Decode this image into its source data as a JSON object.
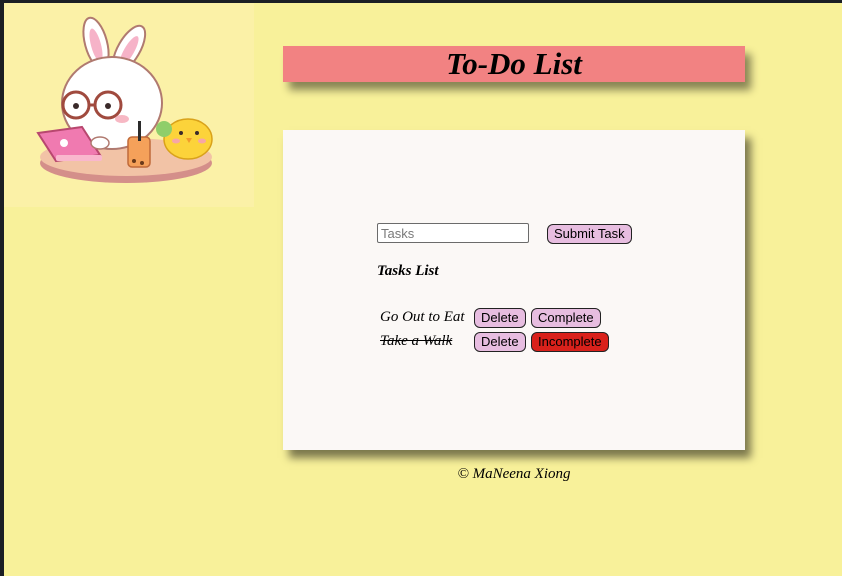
{
  "header": {
    "title": "To-Do List"
  },
  "form": {
    "placeholder": "Tasks",
    "value": "",
    "submit_label": "Submit Task"
  },
  "list": {
    "heading": "Tasks List",
    "tasks": [
      {
        "name": "Go Out to Eat",
        "completed": false,
        "delete_label": "Delete",
        "toggle_label": "Complete"
      },
      {
        "name": "Take a Walk",
        "completed": true,
        "delete_label": "Delete",
        "toggle_label": "Incomplete"
      }
    ]
  },
  "footer": {
    "text": "© MaNeena Xiong"
  },
  "colors": {
    "page_background": "#f8f19a",
    "title_bar": "#f28282",
    "card": "#fbf8f6",
    "button": "#e7bde0",
    "incomplete_button": "#d9211b"
  },
  "icons": {
    "hero": "bunny-with-laptop-and-chick-illustration"
  }
}
